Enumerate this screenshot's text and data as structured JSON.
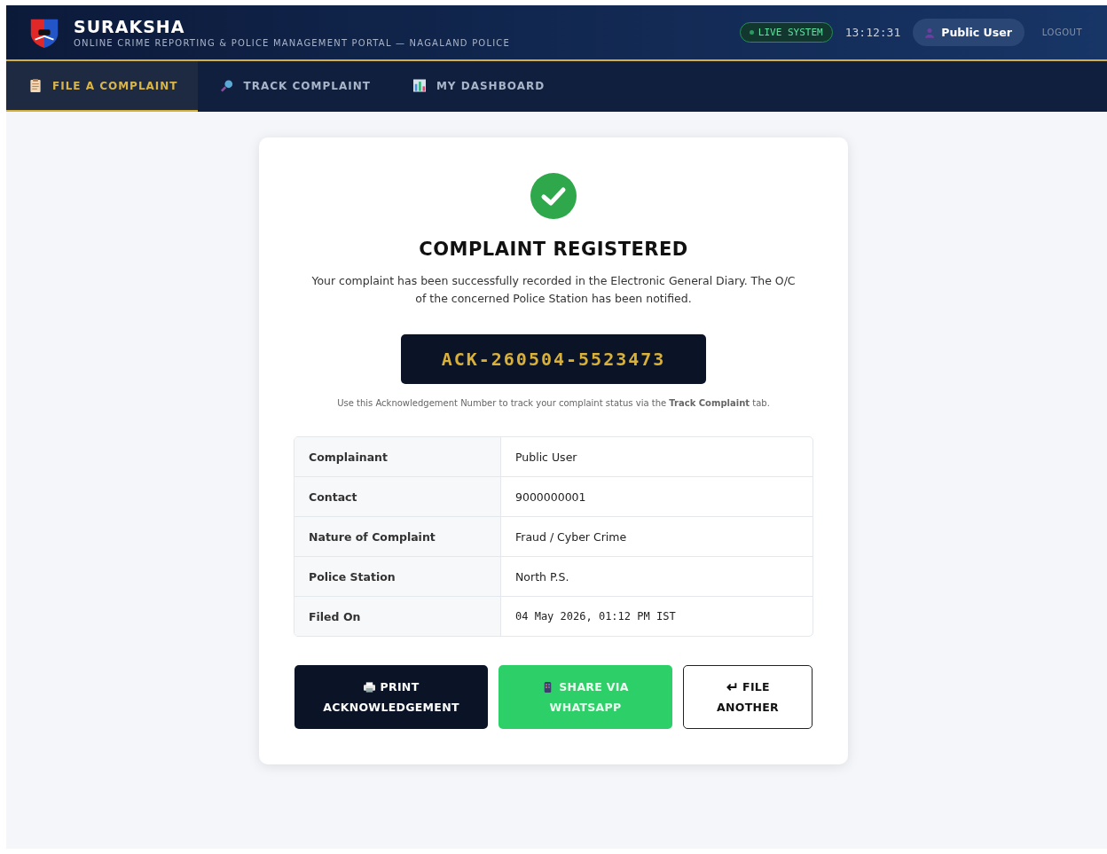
{
  "header": {
    "title": "SURAKSHA",
    "subtitle": "ONLINE CRIME REPORTING & POLICE MANAGEMENT PORTAL — NAGALAND POLICE",
    "status": "LIVE SYSTEM",
    "time": "13:12:31",
    "user": "Public User",
    "logout": "LOGOUT"
  },
  "tabs": [
    {
      "label": "FILE A COMPLAINT",
      "selected": true,
      "kind": "clipboard"
    },
    {
      "label": "TRACK COMPLAINT",
      "selected": false,
      "kind": "search"
    },
    {
      "label": "MY DASHBOARD",
      "selected": false,
      "kind": "chart"
    }
  ],
  "result": {
    "title": "COMPLAINT REGISTERED",
    "message": "Your complaint has been successfully recorded in the Electronic General Diary. The O/C of the concerned Police Station has been notified.",
    "ack_number": "ACK-260504-5523473",
    "hint": "Use this Acknowledgement Number to track your complaint status via the **Track Complaint** tab."
  },
  "details": [
    {
      "label": "Complainant",
      "value": "Public User",
      "kind": "text"
    },
    {
      "label": "Contact",
      "value": "9000000001",
      "kind": "text"
    },
    {
      "label": "Nature of Complaint",
      "value": "Fraud / Cyber Crime",
      "kind": "text"
    },
    {
      "label": "Police Station",
      "value": "North P.S.",
      "kind": "text"
    },
    {
      "label": "Filed On",
      "value": "04 May 2026, 01:12 PM IST",
      "kind": "mono"
    }
  ],
  "buttons": [
    {
      "line1": "PRINT",
      "line2": "ACKNOWLEDGEMENT",
      "kind": "print"
    },
    {
      "line1": "SHARE VIA",
      "line2": "WHATSAPP",
      "kind": "share"
    },
    {
      "line1": "FILE",
      "line2": "ANOTHER",
      "kind": "another"
    }
  ]
}
